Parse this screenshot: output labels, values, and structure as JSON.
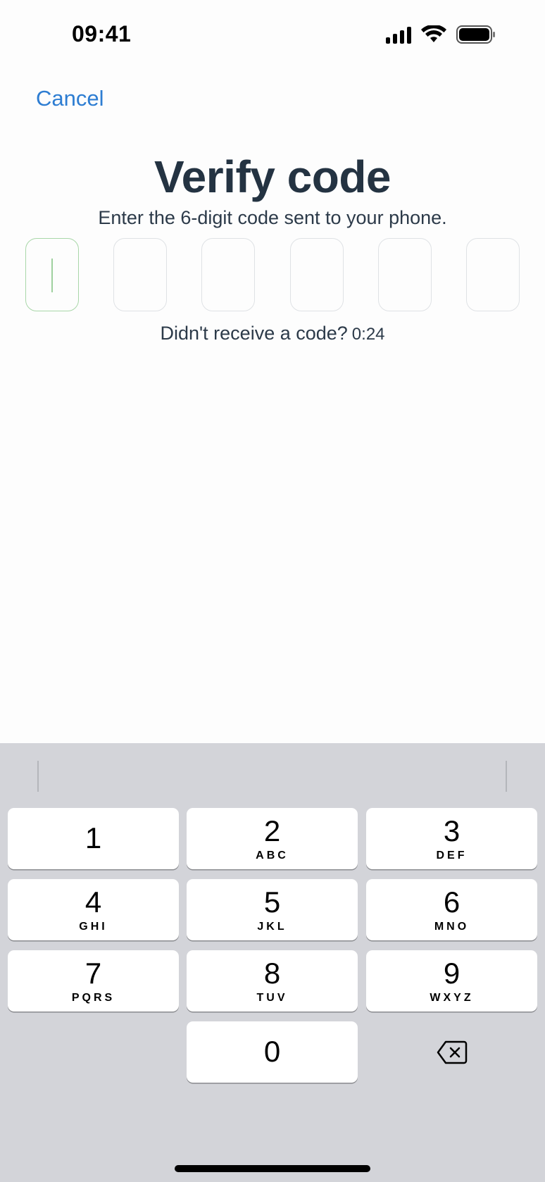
{
  "status_bar": {
    "time": "09:41",
    "icons": [
      "cellular-signal-icon",
      "wifi-icon",
      "battery-icon"
    ]
  },
  "nav": {
    "cancel_label": "Cancel"
  },
  "header": {
    "title": "Verify code",
    "subtitle": "Enter the 6-digit code sent to your phone."
  },
  "code_input": {
    "length": 6,
    "values": [
      "",
      "",
      "",
      "",
      "",
      ""
    ],
    "active_index": 0
  },
  "resend": {
    "label": "Didn't receive a code?",
    "countdown": "0:24"
  },
  "keyboard": {
    "keys": [
      {
        "num": "1",
        "letters": ""
      },
      {
        "num": "2",
        "letters": "ABC"
      },
      {
        "num": "3",
        "letters": "DEF"
      },
      {
        "num": "4",
        "letters": "GHI"
      },
      {
        "num": "5",
        "letters": "JKL"
      },
      {
        "num": "6",
        "letters": "MNO"
      },
      {
        "num": "7",
        "letters": "PQRS"
      },
      {
        "num": "8",
        "letters": "TUV"
      },
      {
        "num": "9",
        "letters": "WXYZ"
      },
      {
        "num": "0",
        "letters": ""
      }
    ],
    "delete_icon": "backspace-icon"
  },
  "colors": {
    "accent": "#2d7dd2",
    "title": "#243342",
    "active_border": "#a9d7a9",
    "keyboard_bg": "#d3d4d9"
  }
}
